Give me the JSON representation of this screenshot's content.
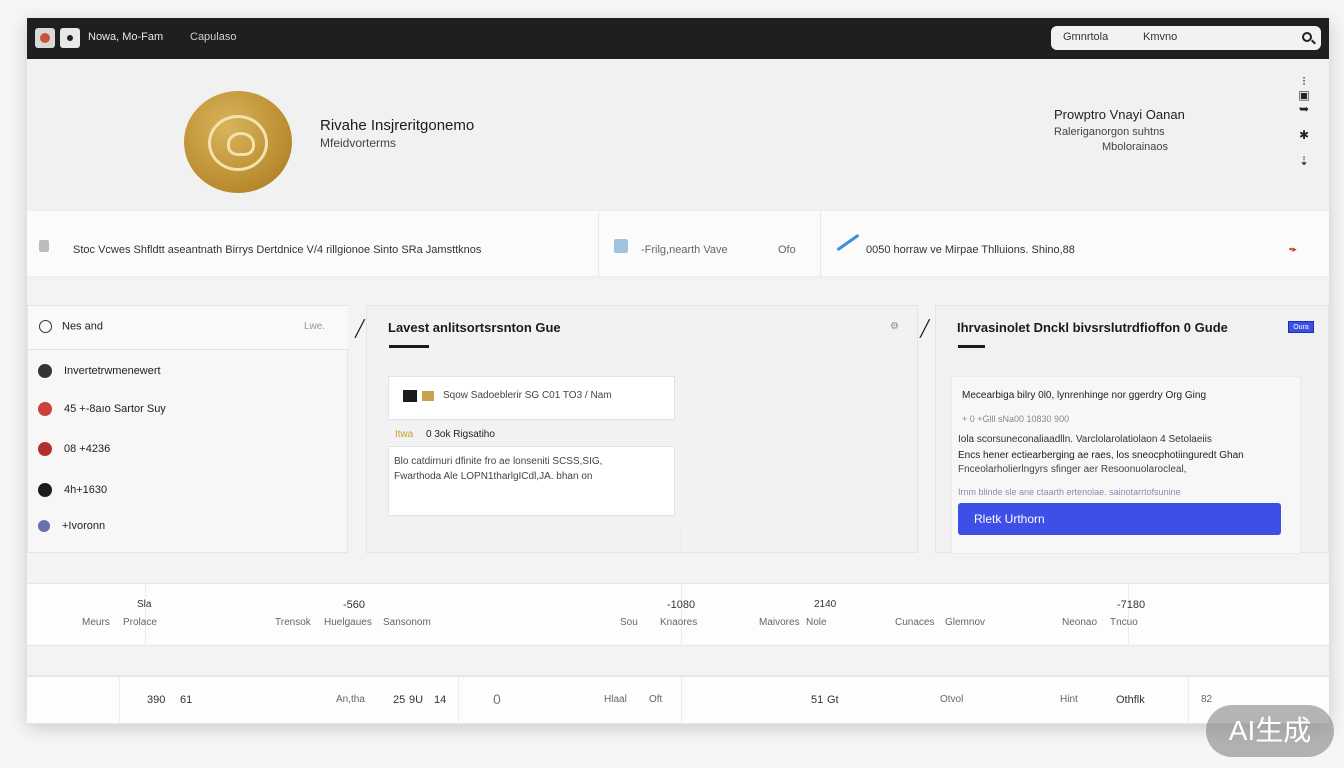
{
  "topbar": {
    "title": "Nowa, Mo-Fam",
    "subtitle": "Capulaso",
    "search": {
      "left": "Gmnrtola",
      "right": "Kmvno"
    }
  },
  "profile": {
    "name": "Rivahe Insjreritgonemo",
    "tagline": "Mfeidvorterms",
    "right_title": "Prowptro Vnayi Oanan",
    "right_line2": "Raleriganorgon suhtns",
    "right_line3": "Mbolorainaos"
  },
  "stats": {
    "segment1": "Stoc Vcwes Shfldtt aseantnath  Birrys  Dertdnice V/4 rillgionoe Sinto SRa  Jamsttknos",
    "segment2": "-Frilg,nearth Vave",
    "segment2b": "Ofo",
    "segment3": "0050 horraw ve Mirpae Thlluions. Shino,88"
  },
  "left_panel": {
    "title": "Nes and",
    "hint": "Lwe.",
    "items": [
      {
        "label": "Invertetrwmenewert",
        "color": "#333"
      },
      {
        "label": "45 +-8aıo Sartor Suy",
        "color": "#c8413b"
      },
      {
        "label": "08 +4236",
        "color": "#b33030"
      },
      {
        "label": "4h+1630",
        "color": "#1b1b1b"
      },
      {
        "label": "+Ivoronn",
        "color": "#6a6fb0"
      }
    ]
  },
  "middle_panel": {
    "title": "Lavest anlitsortsrsnton Gue",
    "card1": "Sqow Sadoeblerir SG C01 TO3 / Nam",
    "highlight_prefix": "Itwa",
    "highlight_text": "0 3ok Rigsatiho",
    "card2_line1": "Blo catdirnuri dfinite fro ae lonseniti SCSS,SIG,",
    "card2_line2": "Fwarthoda Ale LOPN1tharlgICdl,JA. bhan on"
  },
  "right_panel": {
    "title": "Ihrvasinolet Dnckl bivsrslutrdfioffon 0 Gude",
    "tag": "Oura",
    "line1": "Mecearbiga bilry 0l0, lynrenhinge nor ggerdry Org Ging",
    "line2": "+ 0 +Glll sNa00 10830 900",
    "line3": "Iola scorsuneconaliaadlln. Varclolarolatiolaon 4 Setolaeiis",
    "line4": "Encs hener ectiearberging ae raes, los sneocphotiinguredt Ghan",
    "line5": "Fnceolarholierlngyrs sfinger aer Resoonuolarocleal,",
    "line6": "Irnm blinde sle ane ctaarth ertenolae. sainotarrtofsunine",
    "button": "Rletk  Urthorn"
  },
  "table": {
    "row1_top": [
      "Sla",
      "-560",
      "-1080",
      "2140",
      "-7180"
    ],
    "row1_bottom": [
      "Meurs",
      "Prolace",
      "Trensok",
      "Huelgaues",
      "Sansonom",
      "Sou",
      "Knaores",
      "Maivores",
      "Nole",
      "Cunaces",
      "Glemnov",
      "Neonao",
      "Tncuo"
    ],
    "row2": [
      "390",
      "61",
      "An,tha",
      "25",
      "9U",
      "14",
      "0",
      "Hlaal",
      "Oft",
      "51",
      "Gt",
      "Otvol",
      "Hint",
      "Othflk",
      "82"
    ]
  },
  "watermark": "AI生成"
}
